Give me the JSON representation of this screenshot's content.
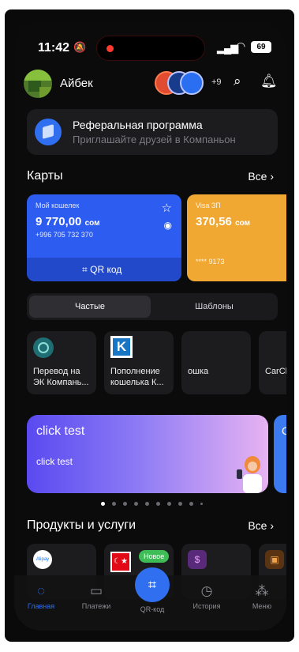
{
  "status_bar": {
    "time": "11:42",
    "battery": "69"
  },
  "header": {
    "username": "Айбек",
    "stories_more": "+9"
  },
  "referral": {
    "title": "Реферальная программа",
    "subtitle": "Приглашайте друзей в Компаньон"
  },
  "cards_section": {
    "title": "Карты",
    "all": "Все ›"
  },
  "cards": [
    {
      "label": "Мой кошелек",
      "amount": "9 770,00",
      "currency": "сом",
      "phone": "+996 705 732 370",
      "qr_label": "QR код",
      "color": "#2d5cf0"
    },
    {
      "label": "Visa ЗП",
      "amount": "370,56",
      "currency": "сом",
      "number": "**** 9173",
      "color": "#f0a832"
    }
  ],
  "segments": {
    "frequent": "Частые",
    "templates": "Шаблоны"
  },
  "quick_tiles": [
    {
      "line1": "Перевод на",
      "line2": "ЭК Компань..."
    },
    {
      "line1": "Пополнение",
      "line2": "кошелька К..."
    },
    {
      "line1": "ошка",
      "line2": ""
    },
    {
      "line1": "CarCh",
      "line2": ""
    }
  ],
  "banner": {
    "title": "click test",
    "subtitle": "click test",
    "next_letter": "С"
  },
  "products_section": {
    "title": "Продукты и услуги",
    "all": "Все ›"
  },
  "products": {
    "alipay": "Alipay",
    "new_badge": "Новое"
  },
  "tabbar": {
    "home": "Главная",
    "payments": "Платежи",
    "qr": "QR-код",
    "history": "История",
    "menu": "Меню"
  },
  "colors": {
    "accent": "#2f6ff0",
    "background": "#0b0b0c",
    "surface": "#1c1c1f"
  }
}
